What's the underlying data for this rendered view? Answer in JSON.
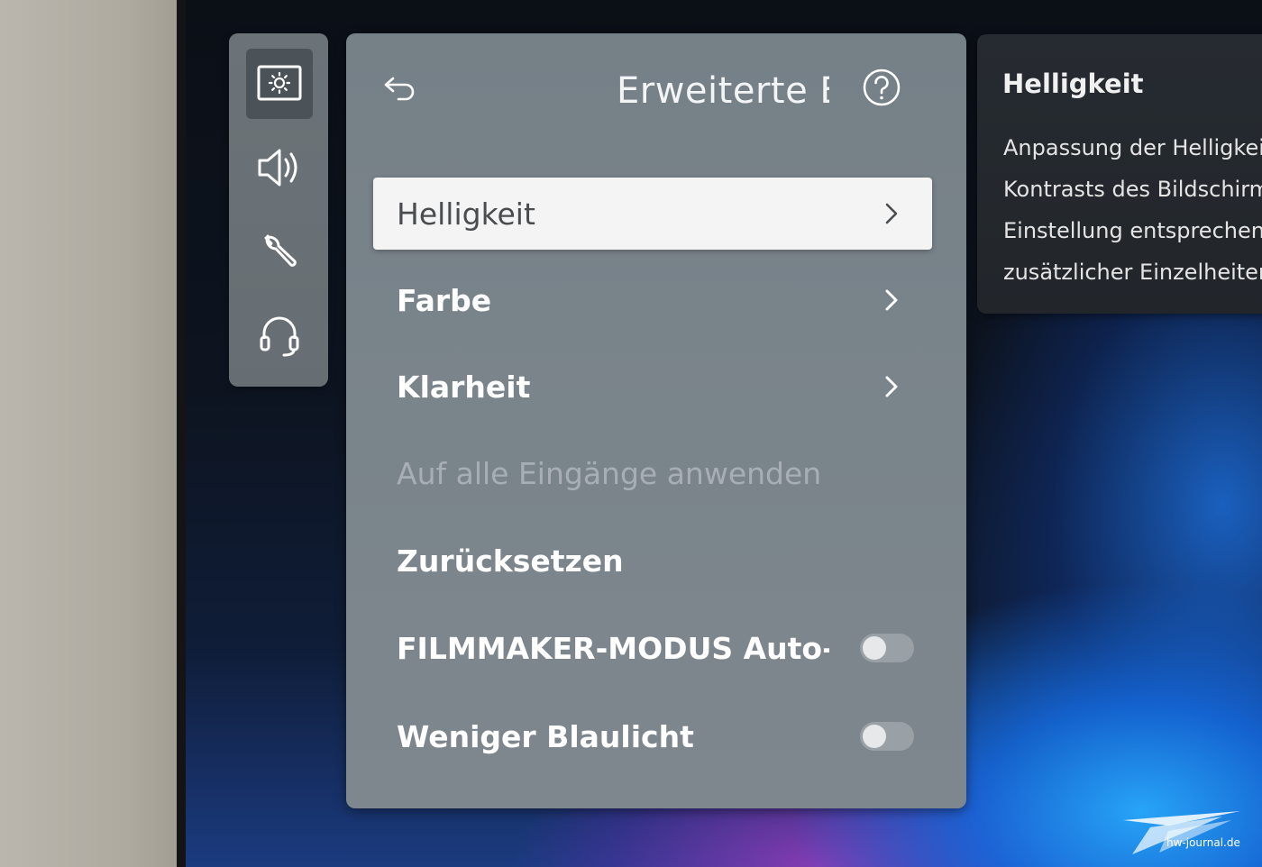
{
  "sidebar": {
    "items": [
      {
        "icon": "picture-brightness-icon",
        "active": true
      },
      {
        "icon": "speaker-icon",
        "active": false
      },
      {
        "icon": "wrench-icon",
        "active": false
      },
      {
        "icon": "headset-icon",
        "active": false
      }
    ]
  },
  "panel": {
    "title": "Erweiterte Einstellungen",
    "back_icon": "back-arrow-icon",
    "help_icon": "help-icon",
    "items": [
      {
        "label": "Helligkeit",
        "type": "submenu",
        "selected": true
      },
      {
        "label": "Farbe",
        "type": "submenu"
      },
      {
        "label": "Klarheit",
        "type": "submenu"
      },
      {
        "label": "Auf alle Eingänge anwenden",
        "type": "action",
        "disabled": true
      },
      {
        "label": "Zurücksetzen",
        "type": "action"
      },
      {
        "label": "FILMMAKER-MODUS Auto-...",
        "type": "toggle",
        "value": "off"
      },
      {
        "label": "Weniger Blaulicht",
        "type": "toggle",
        "value": "off"
      }
    ]
  },
  "info": {
    "title": "Helligkeit",
    "lines": [
      "Anpassung der Helligkeit",
      "Kontrasts des Bildschirm",
      "Einstellung entsprechend",
      "zusätzlicher Einzelheiten"
    ]
  },
  "watermark": {
    "text": "hw-journal.de"
  },
  "colors": {
    "panel": "#7a848b",
    "selected_row": "#f4f4f4",
    "info_panel": "#24292e",
    "screen_blue": "#1e6fe0"
  }
}
